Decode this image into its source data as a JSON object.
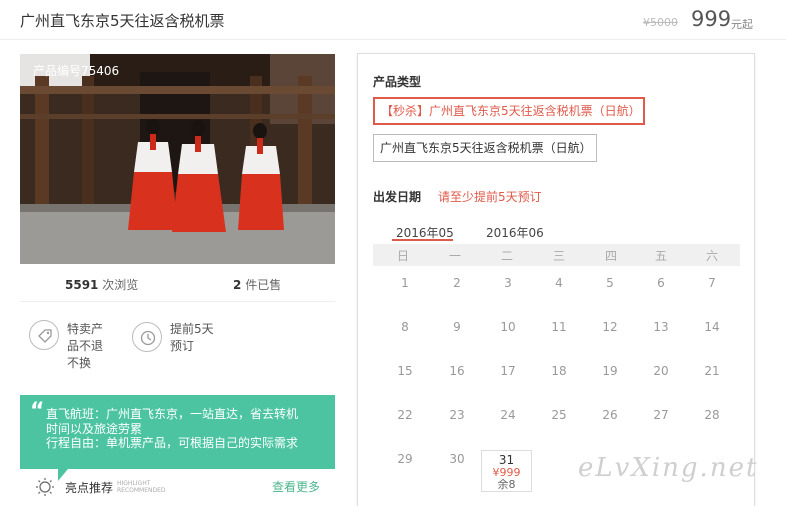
{
  "header": {
    "title": "广州直飞东京5天往返含税机票",
    "old_price": "¥5000",
    "price": "999",
    "price_unit": "元起"
  },
  "photo": {
    "product_no": "产品编号75406"
  },
  "stats": {
    "views_num": "5591",
    "views_label": "次浏览",
    "sold_num": "2",
    "sold_label": "件已售"
  },
  "features": [
    {
      "icon": "tag-icon",
      "lines": [
        "特卖产",
        "品不退",
        "不换"
      ]
    },
    {
      "icon": "clock-icon",
      "lines": [
        "提前5天",
        "预订"
      ]
    }
  ],
  "highlight": {
    "quote": "“",
    "lines": [
      "直飞航班：广州直飞东京，一站直达，省去转机",
      "时间以及旅途劳累",
      "行程自由：单机票产品，可根据自己的实际需求"
    ]
  },
  "recommend": {
    "label": "亮点推荐",
    "sub1": "HIGHLIGHT",
    "sub2": "RECOMMENDED",
    "more": "查看更多"
  },
  "product_type": {
    "title": "产品类型",
    "options": [
      {
        "label": "【秒杀】广州直飞东京5天往返含税机票（日航）",
        "selected": true
      },
      {
        "label": "广州直飞东京5天往返含税机票（日航）",
        "selected": false
      }
    ]
  },
  "departure": {
    "title": "出发日期",
    "hint": "请至少提前5天预订",
    "months": [
      {
        "label": "2016年05",
        "active": true
      },
      {
        "label": "2016年06",
        "active": false
      }
    ],
    "weekdays": [
      "日",
      "一",
      "二",
      "三",
      "四",
      "五",
      "六"
    ],
    "weeks": [
      [
        "1",
        "2",
        "3",
        "4",
        "5",
        "6",
        "7"
      ],
      [
        "8",
        "9",
        "10",
        "11",
        "12",
        "13",
        "14"
      ],
      [
        "15",
        "16",
        "17",
        "18",
        "19",
        "20",
        "21"
      ],
      [
        "22",
        "23",
        "24",
        "25",
        "26",
        "27",
        "28"
      ],
      [
        "29",
        "30"
      ]
    ],
    "available": {
      "day": "31",
      "price": "¥999",
      "remain": "余8"
    }
  },
  "watermark": "eLvXing.net",
  "colors": {
    "accent": "#e05a4a",
    "green": "#4cc4a2"
  }
}
